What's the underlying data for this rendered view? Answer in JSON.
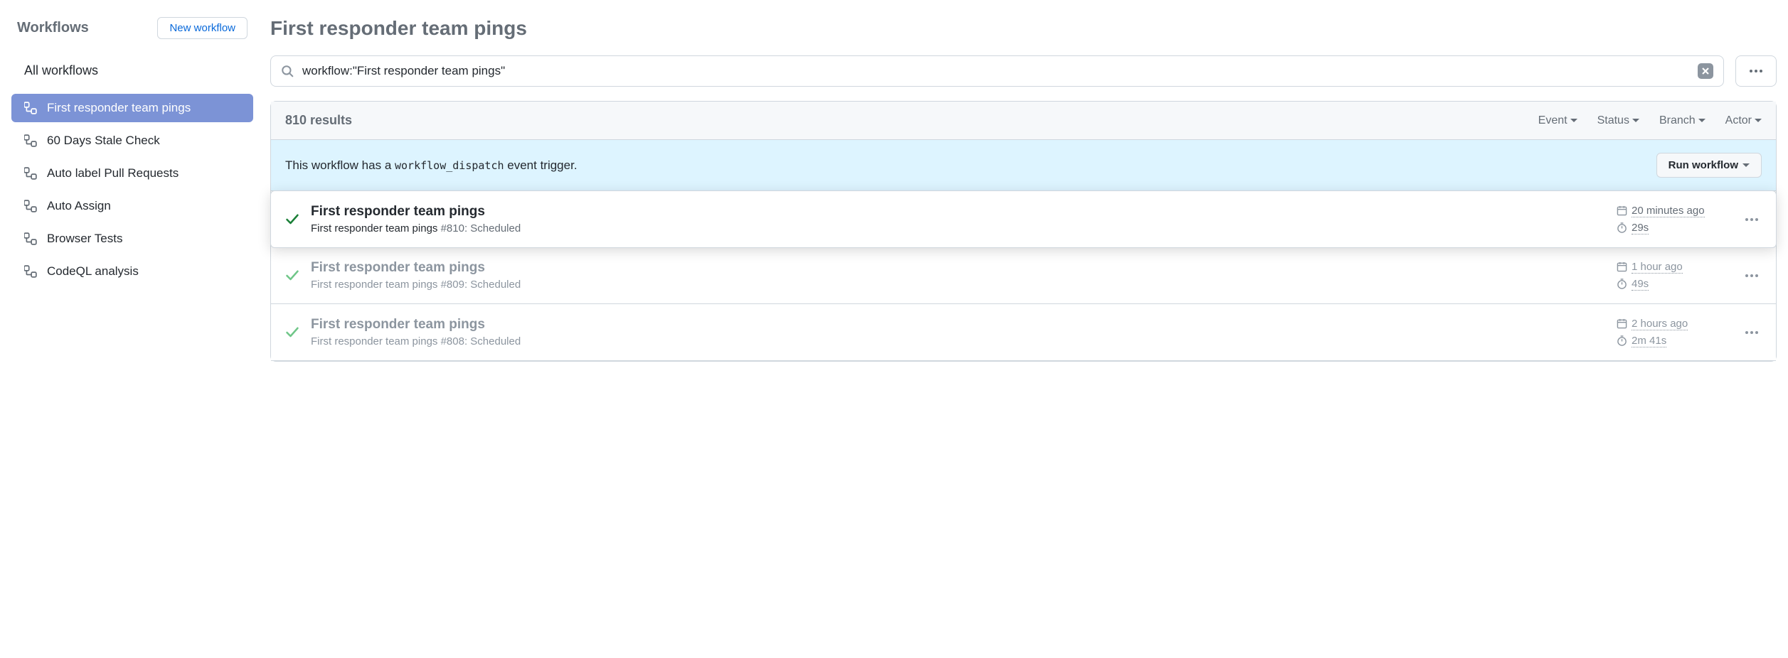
{
  "sidebar": {
    "title": "Workflows",
    "new_workflow_label": "New workflow",
    "all_label": "All workflows",
    "items": [
      {
        "label": "First responder team pings",
        "active": true
      },
      {
        "label": "60 Days Stale Check",
        "active": false
      },
      {
        "label": "Auto label Pull Requests",
        "active": false
      },
      {
        "label": "Auto Assign",
        "active": false
      },
      {
        "label": "Browser Tests",
        "active": false
      },
      {
        "label": "CodeQL analysis",
        "active": false
      }
    ]
  },
  "main": {
    "title": "First responder team pings",
    "search_value": "workflow:\"First responder team pings\"",
    "results_count": "810 results",
    "filters": {
      "event": "Event",
      "status": "Status",
      "branch": "Branch",
      "actor": "Actor"
    },
    "dispatch": {
      "prefix": "This workflow has a ",
      "code": "workflow_dispatch",
      "suffix": " event trigger.",
      "button": "Run workflow"
    },
    "runs": [
      {
        "title": "First responder team pings",
        "wf": "First responder team pings",
        "num": "#810",
        "trigger": "Scheduled",
        "time": "20 minutes ago",
        "duration": "29s",
        "highlighted": true
      },
      {
        "title": "First responder team pings",
        "wf": "First responder team pings",
        "num": "#809",
        "trigger": "Scheduled",
        "time": "1 hour ago",
        "duration": "49s",
        "highlighted": false
      },
      {
        "title": "First responder team pings",
        "wf": "First responder team pings",
        "num": "#808",
        "trigger": "Scheduled",
        "time": "2 hours ago",
        "duration": "2m 41s",
        "highlighted": false
      }
    ]
  }
}
